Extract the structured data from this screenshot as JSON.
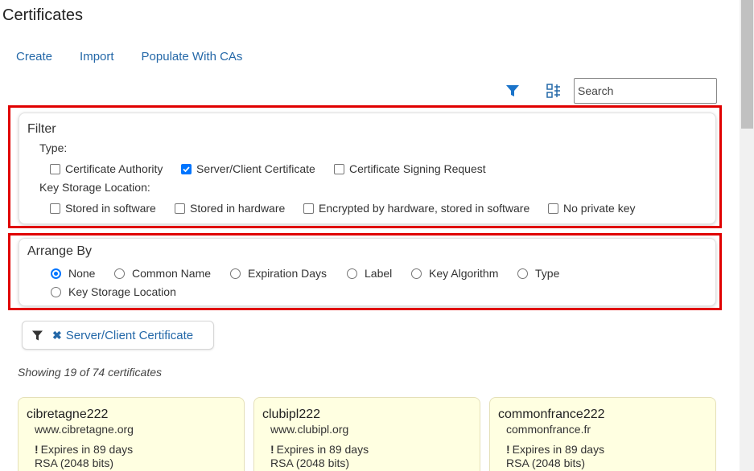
{
  "page": {
    "title": "Certificates"
  },
  "actions": [
    "Create",
    "Import",
    "Populate With CAs"
  ],
  "toolbar": {
    "search_placeholder": "Search",
    "search_value": ""
  },
  "filter": {
    "title": "Filter",
    "type_label": "Type:",
    "types": [
      {
        "label": "Certificate Authority",
        "checked": false
      },
      {
        "label": "Server/Client Certificate",
        "checked": true
      },
      {
        "label": "Certificate Signing Request",
        "checked": false
      }
    ],
    "storage_label": "Key Storage Location:",
    "storage": [
      {
        "label": "Stored in software",
        "checked": false
      },
      {
        "label": "Stored in hardware",
        "checked": false
      },
      {
        "label": "Encrypted by hardware, stored in software",
        "checked": false
      },
      {
        "label": "No private key",
        "checked": false
      }
    ]
  },
  "arrange": {
    "title": "Arrange By",
    "options": [
      {
        "label": "None",
        "checked": true
      },
      {
        "label": "Common Name",
        "checked": false
      },
      {
        "label": "Expiration Days",
        "checked": false
      },
      {
        "label": "Label",
        "checked": false
      },
      {
        "label": "Key Algorithm",
        "checked": false
      },
      {
        "label": "Type",
        "checked": false
      },
      {
        "label": "Key Storage Location",
        "checked": false
      }
    ]
  },
  "active_filter": {
    "remove_icon": "✖",
    "label": "Server/Client Certificate"
  },
  "showing_text": "Showing 19 of 74 certificates",
  "certificates": [
    {
      "name": "cibretagne222",
      "domain": "www.cibretagne.org",
      "expiry_mark": "!",
      "expiry": "Expires in 89 days",
      "algorithm": "RSA (2048 bits)"
    },
    {
      "name": "clubipl222",
      "domain": "www.clubipl.org",
      "expiry_mark": "!",
      "expiry": "Expires in 89 days",
      "algorithm": "RSA (2048 bits)"
    },
    {
      "name": "commonfrance222",
      "domain": "commonfrance.fr",
      "expiry_mark": "!",
      "expiry": "Expires in 89 days",
      "algorithm": "RSA (2048 bits)"
    }
  ],
  "colors": {
    "link": "#2468a8",
    "highlight": "#e00000",
    "card_bg": "#ffffe1",
    "checked": "#0075ff"
  }
}
